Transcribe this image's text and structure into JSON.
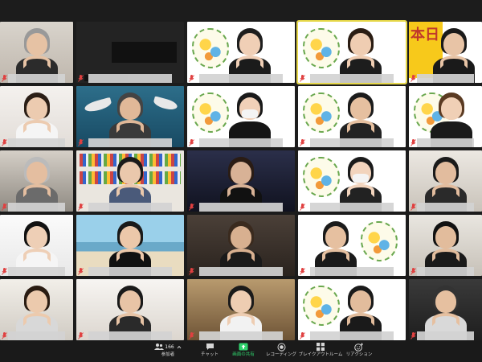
{
  "window": {
    "background": "#1c1c1c"
  },
  "toolbar": {
    "participants": {
      "label": "参加者",
      "count": "166",
      "icon": "participants-icon"
    },
    "chat": {
      "label": "チャット",
      "icon": "chat-icon"
    },
    "share_screen": {
      "label": "画面の共有",
      "icon": "share-screen-icon",
      "color": "#2fd26c"
    },
    "recording": {
      "label": "レコーディング",
      "icon": "record-icon"
    },
    "breakout_rooms": {
      "label": "ブレイクアウトルーム",
      "icon": "breakout-rooms-icon"
    },
    "reactions": {
      "label": "リアクション",
      "icon": "reactions-icon"
    }
  },
  "gallery": {
    "rows": 5,
    "columns": 5,
    "tiles": [
      {
        "id": "r1c1",
        "scene": "webcam-person-indoor"
      },
      {
        "id": "r1c2",
        "scene": "redacted-name-camera-off"
      },
      {
        "id": "r1c3",
        "scene": "logo-background-heart-hands"
      },
      {
        "id": "r1c4",
        "scene": "logo-background-heart-hands-active-speaker"
      },
      {
        "id": "r1c5",
        "scene": "banner-background-heart-hands",
        "banner_text": "本日"
      },
      {
        "id": "r2c1",
        "scene": "person-heart-hands"
      },
      {
        "id": "r2c2",
        "scene": "aquarium-background-heart-hands"
      },
      {
        "id": "r2c3",
        "scene": "logo-background-mask"
      },
      {
        "id": "r2c4",
        "scene": "logo-background-heart-hands"
      },
      {
        "id": "r2c5",
        "scene": "logo-background-person"
      },
      {
        "id": "r3c1",
        "scene": "person-glasses-office"
      },
      {
        "id": "r3c2",
        "scene": "bookshelf-background-heart-hands"
      },
      {
        "id": "r3c3",
        "scene": "dark-room-heart-hands"
      },
      {
        "id": "r3c4",
        "scene": "logo-background-mask-heart-hands"
      },
      {
        "id": "r3c5",
        "scene": "room-background-heart-hands"
      },
      {
        "id": "r4c1",
        "scene": "person-heart-hands-white-room"
      },
      {
        "id": "r4c2",
        "scene": "beach-background-heart-hands"
      },
      {
        "id": "r4c3",
        "scene": "person-heart-hands-dim"
      },
      {
        "id": "r4c4",
        "scene": "logo-background-heart-hands"
      },
      {
        "id": "r4c5",
        "scene": "room-person-heart-hands"
      },
      {
        "id": "r5c1",
        "scene": "office-person-heart-hands"
      },
      {
        "id": "r5c2",
        "scene": "indoor-person-heart-hands"
      },
      {
        "id": "r5c3",
        "scene": "room-person-heart-hands"
      },
      {
        "id": "r5c4",
        "scene": "logo-background-heart-hands"
      },
      {
        "id": "r5c5",
        "scene": "person-glasses-heart-hands"
      }
    ]
  }
}
